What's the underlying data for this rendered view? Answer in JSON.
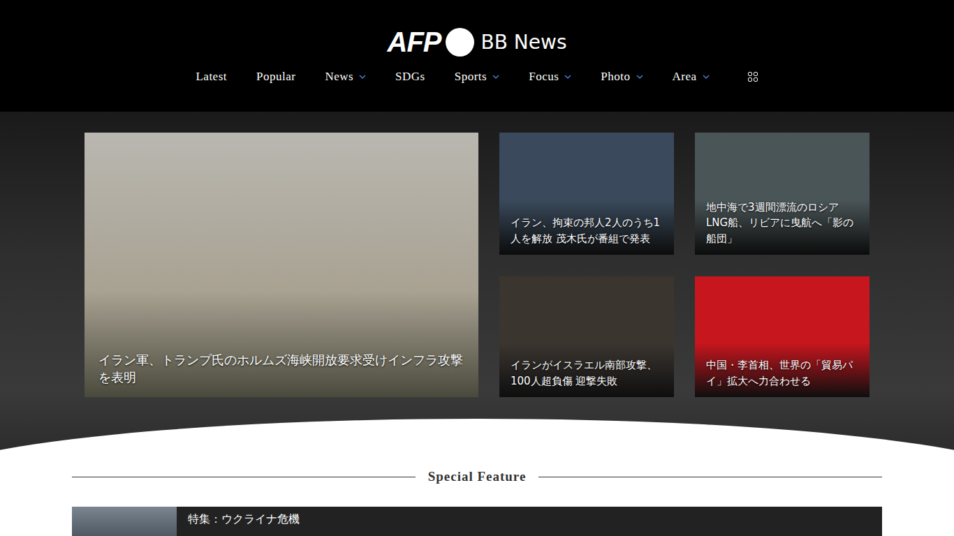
{
  "logo": {
    "brand": "AFP",
    "sub": "BB News"
  },
  "nav": [
    {
      "label": "Latest",
      "dropdown": false
    },
    {
      "label": "Popular",
      "dropdown": false
    },
    {
      "label": "News",
      "dropdown": true
    },
    {
      "label": "SDGs",
      "dropdown": false
    },
    {
      "label": "Sports",
      "dropdown": true
    },
    {
      "label": "Focus",
      "dropdown": true
    },
    {
      "label": "Photo",
      "dropdown": true
    },
    {
      "label": "Area",
      "dropdown": true
    }
  ],
  "headlines": [
    {
      "caption": "イラン軍、トランプ氏のホルムズ海峡開放要求受けインフラ攻撃を表明",
      "color": "#b9b7b0"
    },
    {
      "caption": "イラン、拘束の邦人2人のうち1人を解放 茂木氏が番組で発表",
      "color": "#3a4a5c"
    },
    {
      "caption": "地中海で3週間漂流のロシアLNG船、リビアに曳航へ「影の船団」",
      "color": "#4a5558"
    },
    {
      "caption": "イランがイスラエル南部攻撃、100人超負傷 迎撃失敗",
      "color": "#3b3530"
    },
    {
      "caption": "中国・李首相、世界の「貿易パイ」拡大へ力合わせる",
      "color": "#c8161e"
    }
  ],
  "section": {
    "title": "Special Feature"
  },
  "features": [
    {
      "title": "特集：ウクライナ危機"
    }
  ]
}
